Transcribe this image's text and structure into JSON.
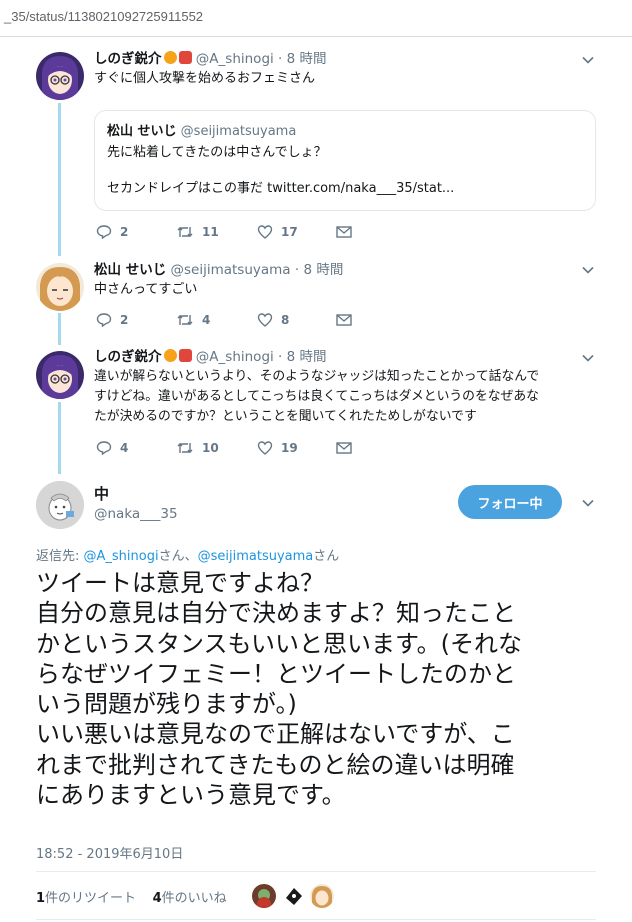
{
  "browser": {
    "url_fragment": "_35/status/1138021092725911552"
  },
  "tweets": [
    {
      "name": "しのぎ鋭介",
      "handle": "@A_shinogi",
      "time": "8 時間",
      "text": "すぐに個人攻撃を始めるおフェミさん",
      "quote": {
        "name": "松山 せいじ",
        "handle": "@seijimatsuyama",
        "line1": "先に粘着してきたのは中さんでしょ？",
        "line2": "セカンドレイプはこの事だ twitter.com/naka___35/stat..."
      },
      "replies": "2",
      "retweets": "11",
      "likes": "17"
    },
    {
      "name": "松山 せいじ",
      "handle": "@seijimatsuyama",
      "time": "8 時間",
      "text": "中さんってすごい",
      "replies": "2",
      "retweets": "4",
      "likes": "8"
    },
    {
      "name": "しのぎ鋭介",
      "handle": "@A_shinogi",
      "time": "8 時間",
      "lines": [
        "違いが解らないというより、そのようなジャッジは知ったことかって話なんで",
        "すけどね。違いがあるとしてこっちは良くてこっちはダメというのをなぜあな",
        "たが決めるのですか？ということを聞いてくれたためしがないです"
      ],
      "replies": "4",
      "retweets": "10",
      "likes": "19"
    }
  ],
  "main": {
    "name": "中",
    "handle": "@naka___35",
    "follow_label": "フォロー中",
    "reply_prefix": "返信先: ",
    "reply_user1": "@A_shinogi",
    "reply_san1": "さん、",
    "reply_user2": "@seijimatsuyama",
    "reply_san2": "さん",
    "lines": [
      "ツイートは意見ですよね？",
      "自分の意見は自分で決めますよ？知ったこと",
      "かというスタンスもいいと思います。(それな",
      "らなぜツイフェミー！とツイートしたのかと",
      "いう問題が残りますが。)",
      "いい悪いは意見なので正解はないですが、こ",
      "れまで批判されてきたものと絵の違いは明確",
      "にありますという意見です。"
    ],
    "timestamp": "18:52 - 2019年6月10日",
    "retweet_count": "1",
    "retweet_label": "件のリツイート",
    "like_count": "4",
    "like_label": "件のいいね"
  },
  "colors": {
    "accent": "#1b95e0",
    "follow_bg": "#4aa3df",
    "thread_line": "#a5d9f0",
    "muted": "#657786"
  }
}
